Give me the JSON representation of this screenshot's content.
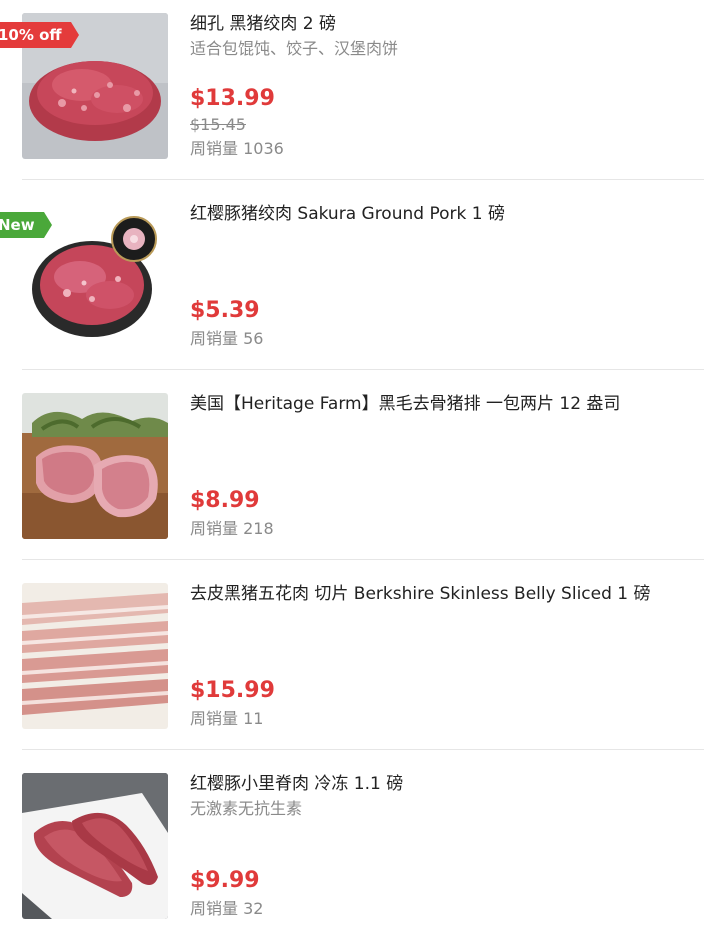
{
  "products": [
    {
      "title": "细孔 黑猪绞肉 2 磅",
      "subtitle": "适合包馄饨、饺子、汉堡肉饼",
      "price": "$13.99",
      "original_price": "$15.45",
      "sales": "周销量 1036",
      "badge": "10% off",
      "image": "ground-pork-image"
    },
    {
      "title": "红樱豚猪绞肉 Sakura Ground Pork 1 磅",
      "price": "$5.39",
      "sales": "周销量 56",
      "badge": "New",
      "image": "sakura-ground-pork-image"
    },
    {
      "title": "美国【Heritage Farm】黑毛去骨猪排 一包两片 12 盎司",
      "price": "$8.99",
      "sales": "周销量 218",
      "image": "pork-chop-image"
    },
    {
      "title": "去皮黑猪五花肉 切片 Berkshire Skinless Belly Sliced 1 磅",
      "price": "$15.99",
      "sales": "周销量 11",
      "image": "pork-belly-image"
    },
    {
      "title": "红樱豚小里脊肉 冷冻 1.1 磅",
      "subtitle": "无激素无抗生素",
      "price": "$9.99",
      "sales": "周销量 32",
      "image": "pork-tenderloin-image"
    }
  ],
  "colors": {
    "price": "#e03a3a",
    "discount_badge": "#e43b3b",
    "new_badge": "#4aa83a",
    "muted_text": "#8a8a8a"
  }
}
